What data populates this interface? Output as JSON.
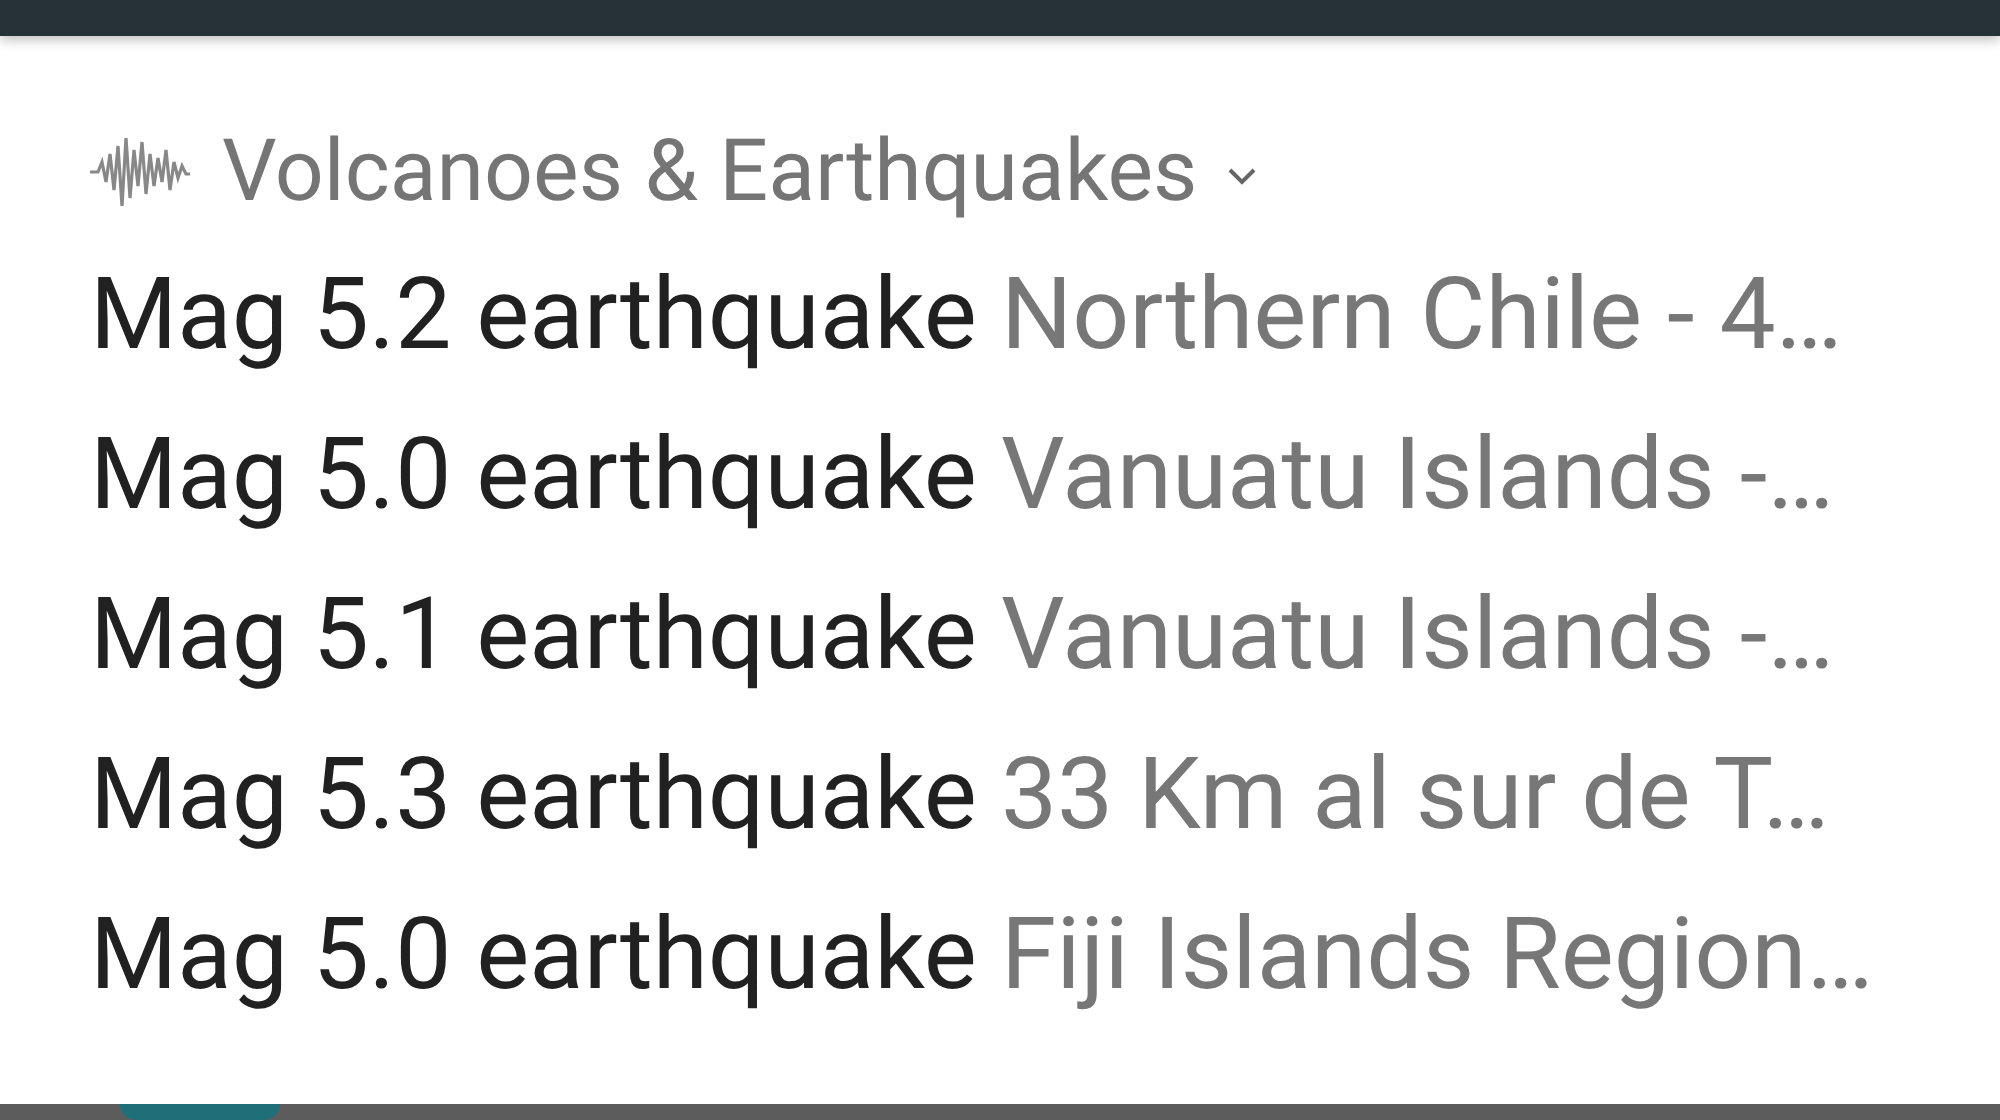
{
  "notification": {
    "app_name": "Volcanoes & Earthquakes",
    "expanded": false,
    "lines": [
      {
        "title": "Mag 5.2 earthquake",
        "text": "Northern Chile - 4…"
      },
      {
        "title": "Mag 5.0 earthquake",
        "text": "Vanuatu Islands -…"
      },
      {
        "title": "Mag 5.1 earthquake",
        "text": "Vanuatu Islands -…"
      },
      {
        "title": "Mag 5.3 earthquake",
        "text": "33 Km al sur de T…"
      },
      {
        "title": "Mag 5.0 earthquake",
        "text": "Fiji Islands Region…"
      }
    ]
  }
}
